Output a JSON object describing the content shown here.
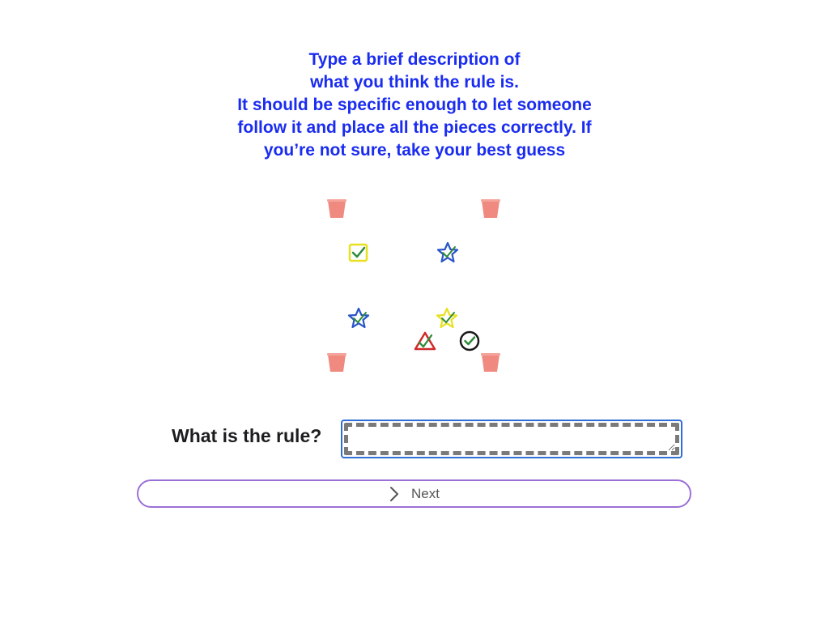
{
  "instructions": {
    "lines": [
      "Type a brief description of",
      "what you think the rule is.",
      "It should be specific enough to let someone",
      "follow it and place all the pieces correctly. If",
      "you’re not sure, take your best guess"
    ],
    "color": "#1a2cf0"
  },
  "board": {
    "pieces": [
      {
        "name": "bucket-icon",
        "color": "#f08a80"
      },
      {
        "name": "bucket-icon",
        "color": "#f08a80"
      },
      {
        "name": "check-square-icon",
        "color": "#e8e020"
      },
      {
        "name": "check-star-icon",
        "color": "#2a55c8"
      },
      {
        "name": "check-star-icon",
        "color": "#2a55c8"
      },
      {
        "name": "check-star-icon",
        "color": "#e8e020"
      },
      {
        "name": "check-triangle-icon",
        "color": "#d02a2a"
      },
      {
        "name": "check-circle-icon",
        "color": "#1a1a1a"
      },
      {
        "name": "bucket-icon",
        "color": "#f08a80"
      },
      {
        "name": "bucket-icon",
        "color": "#f08a80"
      }
    ],
    "check_color": "#2e8b3a"
  },
  "rule": {
    "label": "What is the rule?",
    "value": ""
  },
  "next": {
    "label": "Next",
    "icon": "chevron-right-icon"
  }
}
